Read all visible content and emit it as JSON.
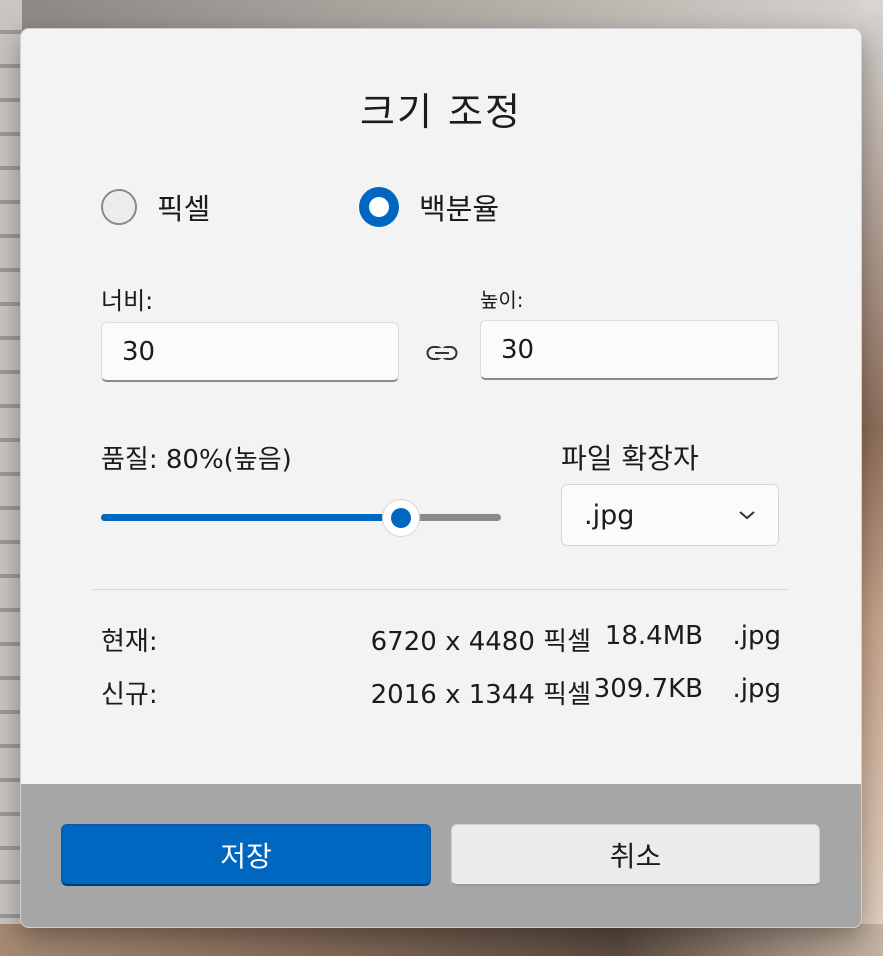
{
  "dialog": {
    "title": "크기 조정"
  },
  "mode": {
    "options": [
      {
        "label": "픽셀",
        "selected": false
      },
      {
        "label": "백분율",
        "selected": true
      }
    ]
  },
  "width": {
    "label": "너비:",
    "value": "30"
  },
  "height": {
    "label": "높이:",
    "value": "30"
  },
  "aspect_lock_icon": "link-icon",
  "quality": {
    "label": "품질: 80%(높음)",
    "slider_percent": 75
  },
  "file_type": {
    "label": "파일 확장자",
    "selected": ".jpg",
    "chevron_icon": "chevron-down-icon"
  },
  "current": {
    "label": "현재:",
    "dimensions": "6720 x 4480 픽셀",
    "size": "18.4MB",
    "ext": ".jpg"
  },
  "new": {
    "label": "신규:",
    "dimensions": "2016 x 1344 픽셀",
    "size": "309.7KB",
    "ext": ".jpg"
  },
  "buttons": {
    "save": "저장",
    "cancel": "취소"
  },
  "colors": {
    "accent": "#0067c0",
    "dialog_bg": "#f3f3f3",
    "footer_bg": "#a6a6a6"
  }
}
